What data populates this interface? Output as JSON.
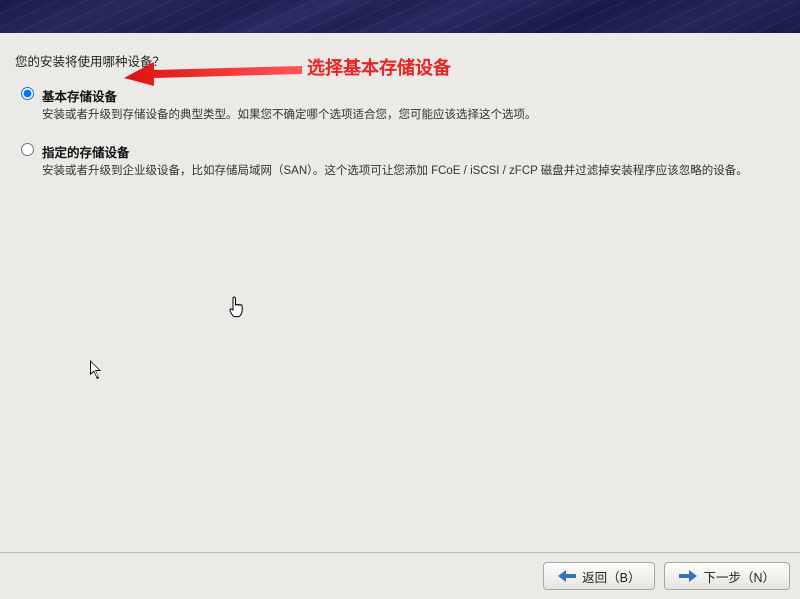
{
  "prompt": "您的安装将使用哪种设备？",
  "options": [
    {
      "title": "基本存储设备",
      "desc": "安装或者升级到存储设备的典型类型。如果您不确定哪个选项适合您，您可能应该选择这个选项。",
      "selected": true
    },
    {
      "title": "指定的存储设备",
      "desc": "安装或者升级到企业级设备，比如存储局域网（SAN）。这个选项可让您添加 FCoE / iSCSI / zFCP 磁盘并过滤掉安装程序应该忽略的设备。",
      "selected": false
    }
  ],
  "annotation": "选择基本存储设备",
  "buttons": {
    "back": "返回（B）",
    "next": "下一步（N）"
  },
  "colors": {
    "annotation": "#e22",
    "arrow": "#3b6fbf"
  }
}
